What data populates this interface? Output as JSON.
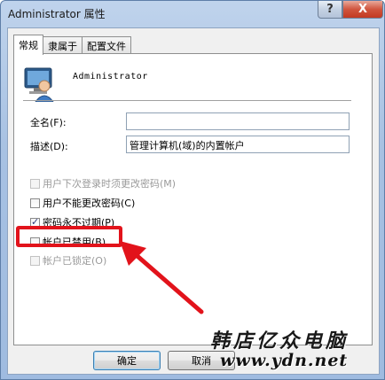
{
  "window": {
    "title": "Administrator 属性",
    "help_label": "?",
    "close_label": "X"
  },
  "tabs": [
    {
      "label": "常规",
      "active": true
    },
    {
      "label": "隶属于",
      "active": false
    },
    {
      "label": "配置文件",
      "active": false
    }
  ],
  "user": {
    "name": "Administrator",
    "icon": "user-icon"
  },
  "fields": {
    "fullname_label": "全名(F):",
    "fullname_value": "",
    "description_label": "描述(D):",
    "description_value": "管理计算机(域)的内置帐户"
  },
  "options": [
    {
      "label": "用户下次登录时须更改密码(M)",
      "checked": false,
      "enabled": false
    },
    {
      "label": "用户不能更改密码(C)",
      "checked": false,
      "enabled": true
    },
    {
      "label": "密码永不过期(P)",
      "checked": true,
      "enabled": true
    },
    {
      "label": "帐户已禁用(B)",
      "checked": false,
      "enabled": true
    },
    {
      "label": "帐户已锁定(O)",
      "checked": false,
      "enabled": false
    }
  ],
  "buttons": {
    "ok": "确定",
    "cancel": "取消"
  },
  "watermark": {
    "brand": "韩店亿众电脑",
    "url": "www.ydn.net"
  },
  "colors": {
    "highlight": "#e2131b",
    "title_bar": "#a7c1e2"
  }
}
